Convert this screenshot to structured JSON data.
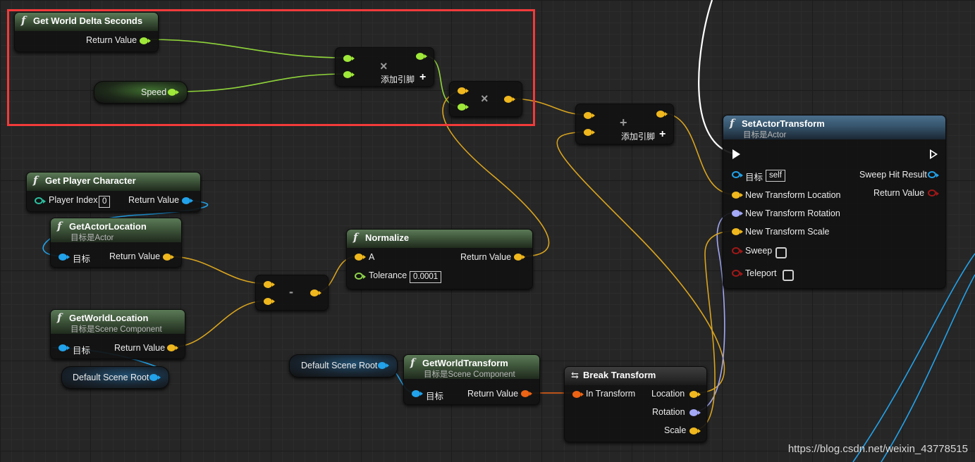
{
  "nodes": {
    "get_world_delta_seconds": {
      "title": "Get World Delta Seconds",
      "return_value": "Return Value"
    },
    "speed_var": {
      "label": "Speed"
    },
    "multiply1": {
      "symbol": "×",
      "add_pin": "添加引脚"
    },
    "multiply2": {
      "symbol": "×"
    },
    "add": {
      "symbol": "+",
      "add_pin": "添加引脚"
    },
    "set_actor_transform": {
      "title": "SetActorTransform",
      "subtitle": "目标是Actor",
      "target_label": "目标",
      "target_value": "self",
      "sweep_hit_result": "Sweep Hit Result",
      "return_value": "Return Value",
      "new_location": "New Transform Location",
      "new_rotation": "New Transform Rotation",
      "new_scale": "New Transform Scale",
      "sweep": "Sweep",
      "teleport": "Teleport"
    },
    "get_player_character": {
      "title": "Get Player Character",
      "player_index": "Player Index",
      "player_index_value": "0",
      "return_value": "Return Value"
    },
    "get_actor_location": {
      "title": "GetActorLocation",
      "subtitle": "目标是Actor",
      "target_label": "目标",
      "return_value": "Return Value"
    },
    "normalize": {
      "title": "Normalize",
      "a": "A",
      "tolerance": "Tolerance",
      "tolerance_value": "0.0001",
      "return_value": "Return Value"
    },
    "subtract": {
      "symbol": "-"
    },
    "get_world_location": {
      "title": "GetWorldLocation",
      "subtitle": "目标是Scene Component",
      "target_label": "目标",
      "return_value": "Return Value"
    },
    "default_scene_root_1": {
      "label": "Default Scene Root"
    },
    "default_scene_root_2": {
      "label": "Default Scene Root"
    },
    "get_world_transform": {
      "title": "GetWorldTransform",
      "subtitle": "目标是Scene Component",
      "target_label": "目标",
      "return_value": "Return Value"
    },
    "break_transform": {
      "title": "Break Transform",
      "in_transform": "In Transform",
      "location": "Location",
      "rotation": "Rotation",
      "scale": "Scale"
    }
  },
  "watermark": "https://blog.csdn.net/weixin_43778515",
  "colors": {
    "float_pin": "#9fe83a",
    "vector_pin": "#f0b81e",
    "object_pin": "#22a2ea",
    "transform_pin": "#ed6414",
    "rotator_pin": "#a3a8f7",
    "highlight": "#f23a3a"
  }
}
